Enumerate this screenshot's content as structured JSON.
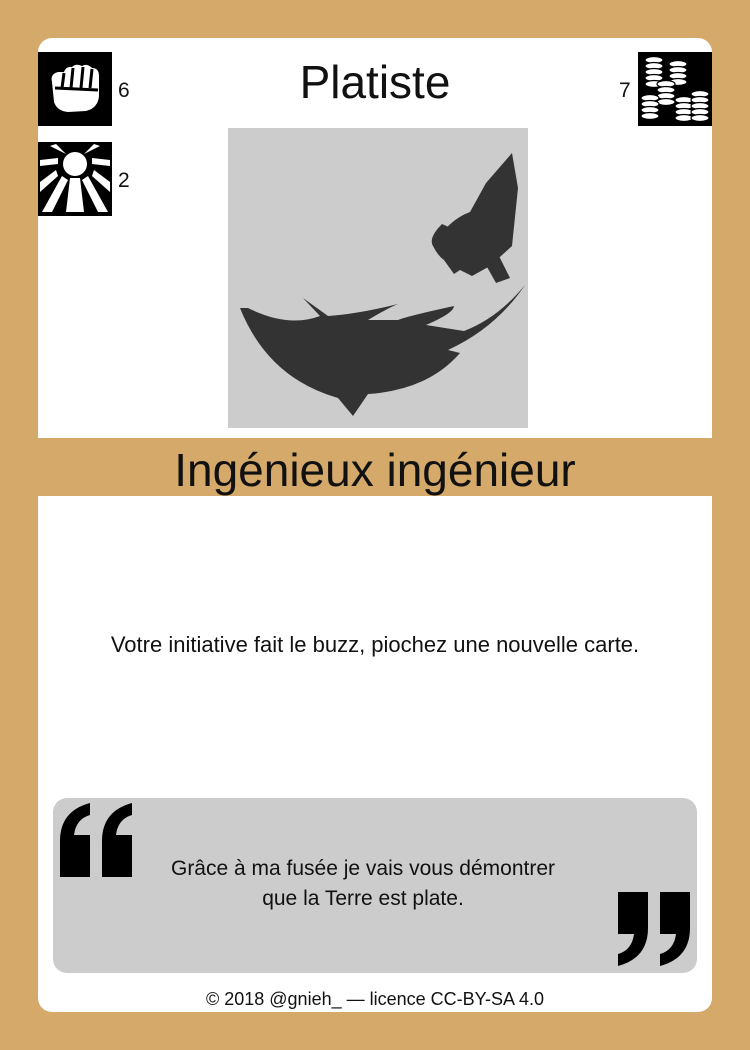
{
  "card": {
    "title": "Platiste",
    "subtitle": "Ingénieux ingénieur",
    "effect": "Votre initiative fait le buzz, piochez une nouvelle carte.",
    "quote_line1": "Grâce à ma fusée je vais vous démontrer",
    "quote_line2": "que la Terre est plate.",
    "footer": "© 2018 @gnieh_ — licence CC-BY-SA 4.0"
  },
  "stats": {
    "strength": {
      "icon": "fist-icon",
      "value": "6"
    },
    "light": {
      "icon": "sunrays-icon",
      "value": "2"
    },
    "cost": {
      "icon": "coin-stacks-icon",
      "value": "7"
    }
  },
  "illustration": {
    "icon": "rocket-icon"
  },
  "colors": {
    "frame": "#d4a96a",
    "panel": "#cccccc",
    "ink": "#333333"
  }
}
